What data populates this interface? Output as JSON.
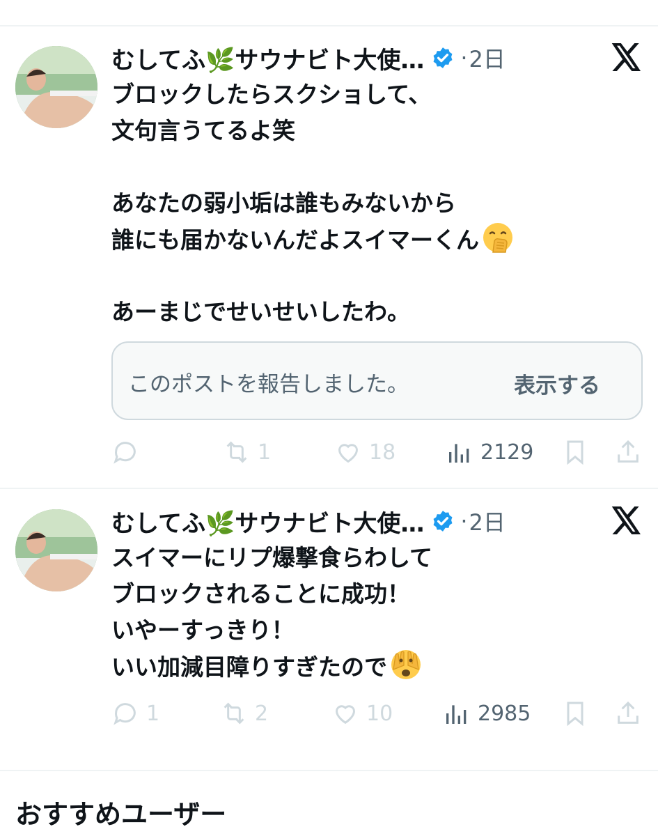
{
  "posts": [
    {
      "author_name": "むしてふ🌿サウナビト大使…",
      "separator": "·",
      "time": "2日",
      "lines": [
        "ブロックしたらスクショして、",
        "文句言うてるよ笑",
        "",
        "あなたの弱小垢は誰もみないから",
        "誰にも届かないんだよスイマーくん",
        "",
        "あーまじでせいせいしたわ。"
      ],
      "emoji": "face-with-hand-over-mouth",
      "reported_text": "このポストを報告しました。",
      "show_label": "表示する",
      "replies": "",
      "reposts": "1",
      "likes": "18",
      "views": "2129"
    },
    {
      "author_name": "むしてふ🌿サウナビト大使…",
      "separator": "·",
      "time": "2日",
      "lines": [
        "スイマーにリプ爆撃食らわして",
        "ブロックされることに成功！",
        "いやーすっきり！",
        "いい加減目障りすぎたので"
      ],
      "emoji": "face-with-peeking-eye",
      "replies": "1",
      "reposts": "2",
      "likes": "10",
      "views": "2985"
    }
  ],
  "recommended_title": "おすすめユーザー",
  "colors": {
    "text": "#0f1419",
    "muted": "#536471",
    "faded": "#cfd9de",
    "verified": "#1d9bf0"
  }
}
